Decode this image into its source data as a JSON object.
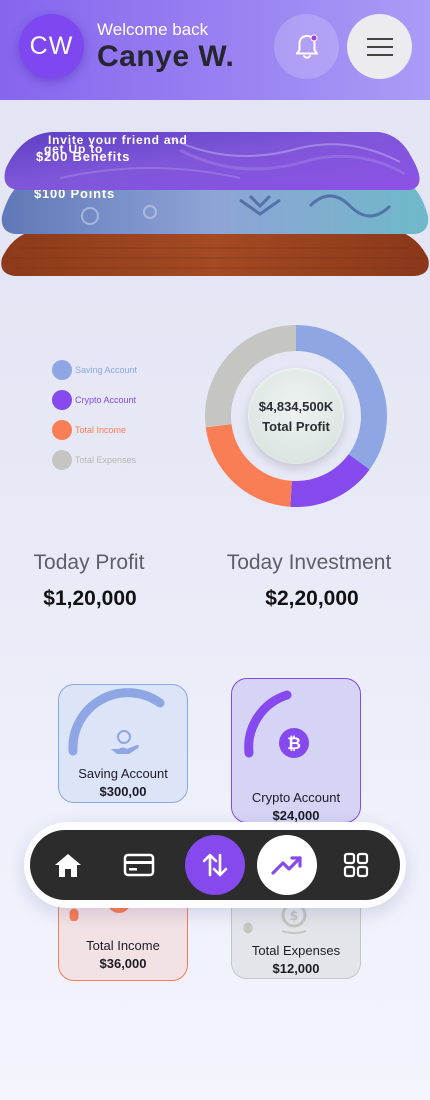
{
  "header": {
    "avatar_initials": "CW",
    "welcome": "Welcome back",
    "user_name": "Canye W."
  },
  "promo_cards": {
    "top_line1": "Invite your friend and",
    "top_line2": "get Up to",
    "top_line3": "$200 Benefits",
    "middle": "$100 Points"
  },
  "chart_data": {
    "type": "pie",
    "categories": [
      "Saving Account",
      "Crypto Account",
      "Total Income",
      "Total Expenses"
    ],
    "values": [
      35,
      16,
      22,
      27
    ],
    "colors": [
      "#8fa6e4",
      "#8549ee",
      "#f97e56",
      "#c5c6c2"
    ],
    "center_value": "$4,834,500K",
    "center_caption": "Total Profit",
    "legend_position": "left"
  },
  "today": {
    "profit_label": "Today Profit",
    "profit_value": "$1,20,000",
    "investment_label": "Today Investment",
    "investment_value": "$2,20,000"
  },
  "accounts": [
    {
      "name": "Saving Account",
      "value": "$300,00",
      "icon": "hand-coin-icon",
      "color": "#8fa6e4"
    },
    {
      "name": "Crypto Account",
      "value": "$24,000",
      "icon": "bitcoin-icon",
      "color": "#8549ee"
    },
    {
      "name": "Total Income",
      "value": "$36,000",
      "icon": "income-icon",
      "color": "#f97e56"
    },
    {
      "name": "Total Expenses",
      "value": "$12,000",
      "icon": "dollar-coin-icon",
      "color": "#c5c6c2"
    }
  ],
  "nav": {
    "items": [
      "home-icon",
      "card-icon",
      "transfer-icon",
      "trending-up-icon",
      "grid-icon"
    ],
    "active": "trending-up-icon",
    "accent": "#8549ee"
  }
}
